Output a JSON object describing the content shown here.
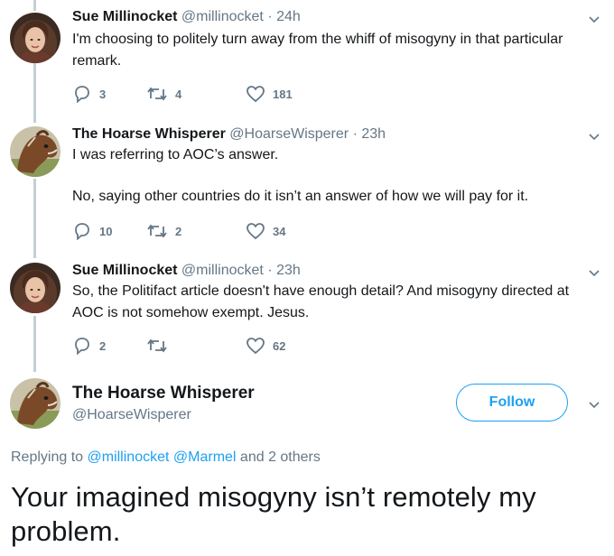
{
  "colors": {
    "accent": "#1da1f2",
    "muted": "#657786",
    "thread_line": "#c4cfd6",
    "text": "#14171a"
  },
  "tweets": [
    {
      "name": "Sue Millinocket",
      "handle": "@millinocket",
      "time": "· 24h",
      "lines": [
        "I'm choosing to politely turn away from the whiff of misogyny in that particular remark."
      ],
      "replies": "3",
      "retweets": "4",
      "likes": "181",
      "avatar": "woman-curly-hair-avatar"
    },
    {
      "name": "The Hoarse Whisperer",
      "handle": "@HoarseWisperer",
      "time": "· 23h",
      "lines": [
        "I was referring to AOC’s answer.",
        "No, saying other countries do it isn’t an answer of how we will pay for it."
      ],
      "replies": "10",
      "retweets": "2",
      "likes": "34",
      "avatar": "horse-avatar"
    },
    {
      "name": "Sue Millinocket",
      "handle": "@millinocket",
      "time": "· 23h",
      "lines": [
        "So, the Politifact article doesn't have enough detail? And misogyny directed at AOC is not somehow exempt. Jesus."
      ],
      "replies": "2",
      "retweets": "",
      "likes": "62",
      "avatar": "woman-curly-hair-avatar"
    }
  ],
  "main_tweet": {
    "name": "The Hoarse Whisperer",
    "handle": "@HoarseWisperer",
    "follow_label": "Follow",
    "replying_prefix": "Replying to",
    "reply_handle_1": "@millinocket",
    "reply_handle_2": "@Marmel",
    "reply_suffix": "and 2 others",
    "text": "Your imagined misogyny isn’t remotely my problem."
  }
}
